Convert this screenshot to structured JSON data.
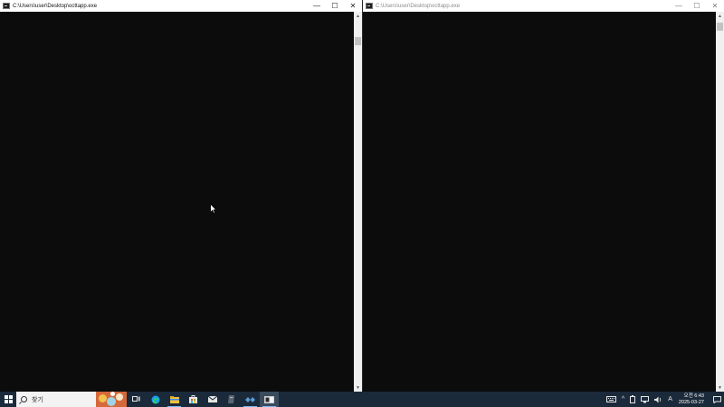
{
  "windows": [
    {
      "title": "C:\\Users\\user\\Desktop\\octtapp.exe",
      "controls": {
        "minimize": "—",
        "maximize": "☐",
        "close": "✕"
      }
    },
    {
      "title": "C:\\Users\\user\\Desktop\\octtapp.exe",
      "controls": {
        "minimize": "—",
        "maximize": "☐",
        "close": "✕"
      }
    }
  ],
  "taskbar": {
    "search_label": "찾기",
    "pinned_icons": [
      "task-view-icon",
      "edge-icon",
      "file-explorer-icon",
      "store-icon",
      "mail-icon",
      "app-icon",
      "visual-studio-icon",
      "console-icon"
    ],
    "tray": {
      "chevron": "^",
      "input_indicator": "A",
      "time": "오전 6:43",
      "date": "2025-03-27"
    }
  },
  "colors": {
    "console_background": "#0c0c0c",
    "taskbar_background": "#1b2a3b",
    "accent": "#76b9ed"
  }
}
